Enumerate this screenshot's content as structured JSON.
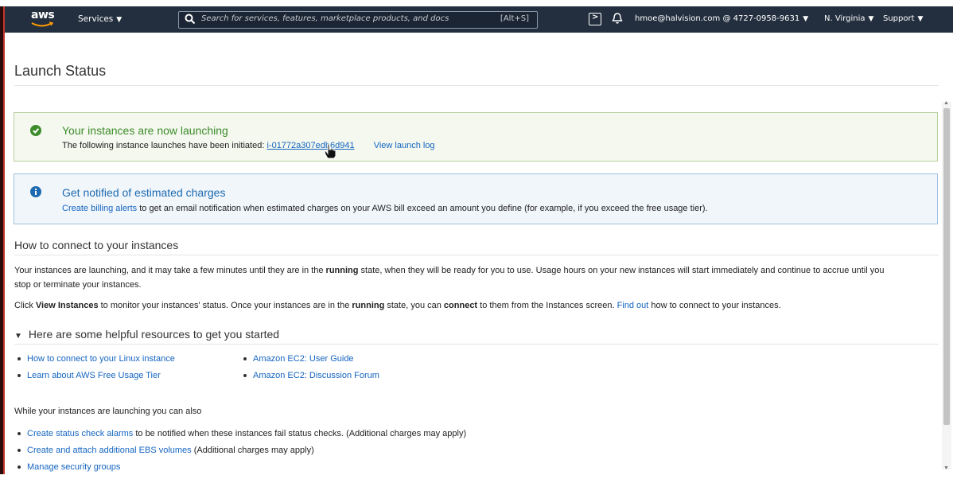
{
  "nav": {
    "logo": "aws",
    "services_label": "Services",
    "search_placeholder": "Search for services, features, marketplace products, and docs",
    "search_shortcut": "[Alt+S]",
    "account": "hmoe@halvision.com @ 4727-0958-9631",
    "region": "N. Virginia",
    "support": "Support",
    "icons": [
      "aws-logo",
      "search-icon",
      "cloudshell-icon",
      "bell-icon",
      "caret-down-icon"
    ],
    "bg_color": "#232f3e"
  },
  "page": {
    "title": "Launch Status"
  },
  "success_alert": {
    "heading": "Your instances are now launching",
    "body_prefix": "The following instance launches have been initiated:",
    "instance_id": "i-01772a307edb6d941",
    "view_log": "View launch log",
    "icon": "check-circle-icon",
    "color": "#3d8b2a"
  },
  "billing_alert": {
    "heading": "Get notified of estimated charges",
    "link": "Create billing alerts",
    "body": "to get an email notification when estimated charges on your AWS bill exceed an amount you define (for example, if you exceed the free usage tier).",
    "icon": "info-circle-icon",
    "color": "#1d6ab0"
  },
  "connect": {
    "heading": "How to connect to your instances",
    "p1_a": "Your instances are launching, and it may take a few minutes until they are in the ",
    "p1_b": "running",
    "p1_c": " state, when they will be ready for you to use. Usage hours on your new instances will start immediately and continue to accrue until you",
    "p1_d": "stop or terminate your instances.",
    "p2_a": "Click ",
    "p2_b": "View Instances",
    "p2_c": " to monitor your instances' status. Once your instances are in the ",
    "p2_d": "running",
    "p2_e": " state, you can ",
    "p2_f": "connect",
    "p2_g": " to them from the Instances screen. ",
    "p2_link": "Find out",
    "p2_h": " how to connect to your instances."
  },
  "resources": {
    "heading": "Here are some helpful resources to get you started",
    "left": [
      "How to connect to your Linux instance",
      "Learn about AWS Free Usage Tier"
    ],
    "right": [
      "Amazon EC2: User Guide",
      "Amazon EC2: Discussion Forum"
    ]
  },
  "also": {
    "heading": "While your instances are launching you can also",
    "items": [
      {
        "link": "Create status check alarms",
        "text": " to be notified when these instances fail status checks. (Additional charges may apply)"
      },
      {
        "link": "Create and attach additional EBS volumes",
        "text": " (Additional charges may apply)"
      },
      {
        "link": "Manage security groups",
        "text": ""
      }
    ]
  }
}
